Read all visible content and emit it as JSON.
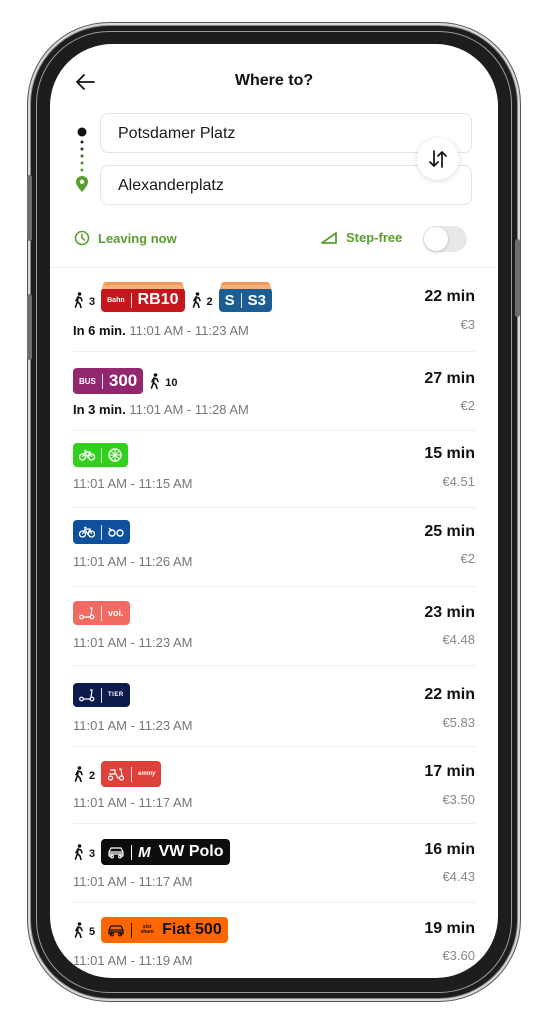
{
  "header": {
    "title": "Where to?",
    "back_icon": "arrow-left-icon"
  },
  "search": {
    "origin": "Potsdamer Platz",
    "destination": "Alexanderplatz",
    "swap_icon": "swap-vertical-icon"
  },
  "options": {
    "leaving_label": "Leaving now",
    "step_free_label": "Step-free",
    "step_free_enabled": false,
    "accent_color": "#5a9e2f"
  },
  "results": [
    {
      "legs": [
        {
          "type": "walk",
          "minutes": "3"
        },
        {
          "type": "badge",
          "provider": "Bahn",
          "line": "RB10",
          "color": "#c4161c"
        },
        {
          "type": "walk",
          "minutes": "2"
        },
        {
          "type": "badge",
          "provider": "S",
          "line": "S3",
          "color": "#1c5e94"
        }
      ],
      "departs_in": "In 6 min.",
      "time_range": "11:01 AM - 11:23 AM",
      "duration": "22 min",
      "price": "€3"
    },
    {
      "legs": [
        {
          "type": "badge",
          "provider": "BUS",
          "line": "300",
          "color": "#92276f"
        },
        {
          "type": "walk",
          "minutes": "10"
        }
      ],
      "departs_in": "In 3 min.",
      "time_range": "11:01 AM - 11:28 AM",
      "duration": "27 min",
      "price": "€2"
    },
    {
      "legs": [
        {
          "type": "badge",
          "provider": "bike",
          "line": "lime",
          "color": "#2fd11c"
        }
      ],
      "time_range": "11:01 AM - 11:15 AM",
      "duration": "15 min",
      "price": "€4.51"
    },
    {
      "legs": [
        {
          "type": "badge",
          "provider": "bike",
          "line": "nextbike",
          "color": "#0e4f9e"
        }
      ],
      "time_range": "11:01 AM - 11:26 AM",
      "duration": "25 min",
      "price": "€2"
    },
    {
      "legs": [
        {
          "type": "badge",
          "provider": "scooter",
          "line": "voi.",
          "color": "#f26b62"
        }
      ],
      "time_range": "11:01 AM - 11:23 AM",
      "duration": "23 min",
      "price": "€4.48"
    },
    {
      "legs": [
        {
          "type": "badge",
          "provider": "scooter",
          "line": "TIER",
          "color": "#0e1b4d"
        }
      ],
      "time_range": "11:01 AM - 11:23 AM",
      "duration": "22 min",
      "price": "€5.83"
    },
    {
      "legs": [
        {
          "type": "walk",
          "minutes": "2"
        },
        {
          "type": "badge",
          "provider": "moped",
          "line": "emmy",
          "color": "#e0403a"
        }
      ],
      "time_range": "11:01 AM - 11:17 AM",
      "duration": "17 min",
      "price": "€3.50"
    },
    {
      "legs": [
        {
          "type": "walk",
          "minutes": "3"
        },
        {
          "type": "badge",
          "provider": "car",
          "brand": "M",
          "line": "VW Polo",
          "color": "#0d0d0d"
        }
      ],
      "time_range": "11:01 AM - 11:17 AM",
      "duration": "16 min",
      "price": "€4.43"
    },
    {
      "legs": [
        {
          "type": "walk",
          "minutes": "5"
        },
        {
          "type": "badge",
          "provider": "car",
          "brand": "sixt share",
          "line": "Fiat 500",
          "color": "#ff6600"
        }
      ],
      "time_range": "11:01 AM - 11:19 AM",
      "duration": "19 min",
      "price": "€3.60"
    }
  ]
}
